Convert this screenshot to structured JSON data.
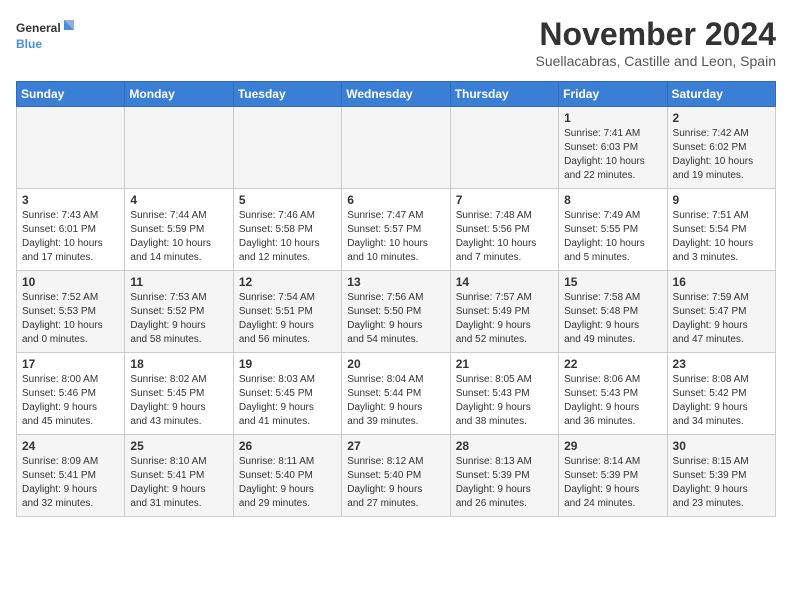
{
  "logo": {
    "line1": "General",
    "line2": "Blue"
  },
  "title": "November 2024",
  "location": "Suellacabras, Castille and Leon, Spain",
  "days_of_week": [
    "Sunday",
    "Monday",
    "Tuesday",
    "Wednesday",
    "Thursday",
    "Friday",
    "Saturday"
  ],
  "weeks": [
    [
      {
        "num": "",
        "info": ""
      },
      {
        "num": "",
        "info": ""
      },
      {
        "num": "",
        "info": ""
      },
      {
        "num": "",
        "info": ""
      },
      {
        "num": "",
        "info": ""
      },
      {
        "num": "1",
        "info": "Sunrise: 7:41 AM\nSunset: 6:03 PM\nDaylight: 10 hours\nand 22 minutes."
      },
      {
        "num": "2",
        "info": "Sunrise: 7:42 AM\nSunset: 6:02 PM\nDaylight: 10 hours\nand 19 minutes."
      }
    ],
    [
      {
        "num": "3",
        "info": "Sunrise: 7:43 AM\nSunset: 6:01 PM\nDaylight: 10 hours\nand 17 minutes."
      },
      {
        "num": "4",
        "info": "Sunrise: 7:44 AM\nSunset: 5:59 PM\nDaylight: 10 hours\nand 14 minutes."
      },
      {
        "num": "5",
        "info": "Sunrise: 7:46 AM\nSunset: 5:58 PM\nDaylight: 10 hours\nand 12 minutes."
      },
      {
        "num": "6",
        "info": "Sunrise: 7:47 AM\nSunset: 5:57 PM\nDaylight: 10 hours\nand 10 minutes."
      },
      {
        "num": "7",
        "info": "Sunrise: 7:48 AM\nSunset: 5:56 PM\nDaylight: 10 hours\nand 7 minutes."
      },
      {
        "num": "8",
        "info": "Sunrise: 7:49 AM\nSunset: 5:55 PM\nDaylight: 10 hours\nand 5 minutes."
      },
      {
        "num": "9",
        "info": "Sunrise: 7:51 AM\nSunset: 5:54 PM\nDaylight: 10 hours\nand 3 minutes."
      }
    ],
    [
      {
        "num": "10",
        "info": "Sunrise: 7:52 AM\nSunset: 5:53 PM\nDaylight: 10 hours\nand 0 minutes."
      },
      {
        "num": "11",
        "info": "Sunrise: 7:53 AM\nSunset: 5:52 PM\nDaylight: 9 hours\nand 58 minutes."
      },
      {
        "num": "12",
        "info": "Sunrise: 7:54 AM\nSunset: 5:51 PM\nDaylight: 9 hours\nand 56 minutes."
      },
      {
        "num": "13",
        "info": "Sunrise: 7:56 AM\nSunset: 5:50 PM\nDaylight: 9 hours\nand 54 minutes."
      },
      {
        "num": "14",
        "info": "Sunrise: 7:57 AM\nSunset: 5:49 PM\nDaylight: 9 hours\nand 52 minutes."
      },
      {
        "num": "15",
        "info": "Sunrise: 7:58 AM\nSunset: 5:48 PM\nDaylight: 9 hours\nand 49 minutes."
      },
      {
        "num": "16",
        "info": "Sunrise: 7:59 AM\nSunset: 5:47 PM\nDaylight: 9 hours\nand 47 minutes."
      }
    ],
    [
      {
        "num": "17",
        "info": "Sunrise: 8:00 AM\nSunset: 5:46 PM\nDaylight: 9 hours\nand 45 minutes."
      },
      {
        "num": "18",
        "info": "Sunrise: 8:02 AM\nSunset: 5:45 PM\nDaylight: 9 hours\nand 43 minutes."
      },
      {
        "num": "19",
        "info": "Sunrise: 8:03 AM\nSunset: 5:45 PM\nDaylight: 9 hours\nand 41 minutes."
      },
      {
        "num": "20",
        "info": "Sunrise: 8:04 AM\nSunset: 5:44 PM\nDaylight: 9 hours\nand 39 minutes."
      },
      {
        "num": "21",
        "info": "Sunrise: 8:05 AM\nSunset: 5:43 PM\nDaylight: 9 hours\nand 38 minutes."
      },
      {
        "num": "22",
        "info": "Sunrise: 8:06 AM\nSunset: 5:43 PM\nDaylight: 9 hours\nand 36 minutes."
      },
      {
        "num": "23",
        "info": "Sunrise: 8:08 AM\nSunset: 5:42 PM\nDaylight: 9 hours\nand 34 minutes."
      }
    ],
    [
      {
        "num": "24",
        "info": "Sunrise: 8:09 AM\nSunset: 5:41 PM\nDaylight: 9 hours\nand 32 minutes."
      },
      {
        "num": "25",
        "info": "Sunrise: 8:10 AM\nSunset: 5:41 PM\nDaylight: 9 hours\nand 31 minutes."
      },
      {
        "num": "26",
        "info": "Sunrise: 8:11 AM\nSunset: 5:40 PM\nDaylight: 9 hours\nand 29 minutes."
      },
      {
        "num": "27",
        "info": "Sunrise: 8:12 AM\nSunset: 5:40 PM\nDaylight: 9 hours\nand 27 minutes."
      },
      {
        "num": "28",
        "info": "Sunrise: 8:13 AM\nSunset: 5:39 PM\nDaylight: 9 hours\nand 26 minutes."
      },
      {
        "num": "29",
        "info": "Sunrise: 8:14 AM\nSunset: 5:39 PM\nDaylight: 9 hours\nand 24 minutes."
      },
      {
        "num": "30",
        "info": "Sunrise: 8:15 AM\nSunset: 5:39 PM\nDaylight: 9 hours\nand 23 minutes."
      }
    ]
  ]
}
